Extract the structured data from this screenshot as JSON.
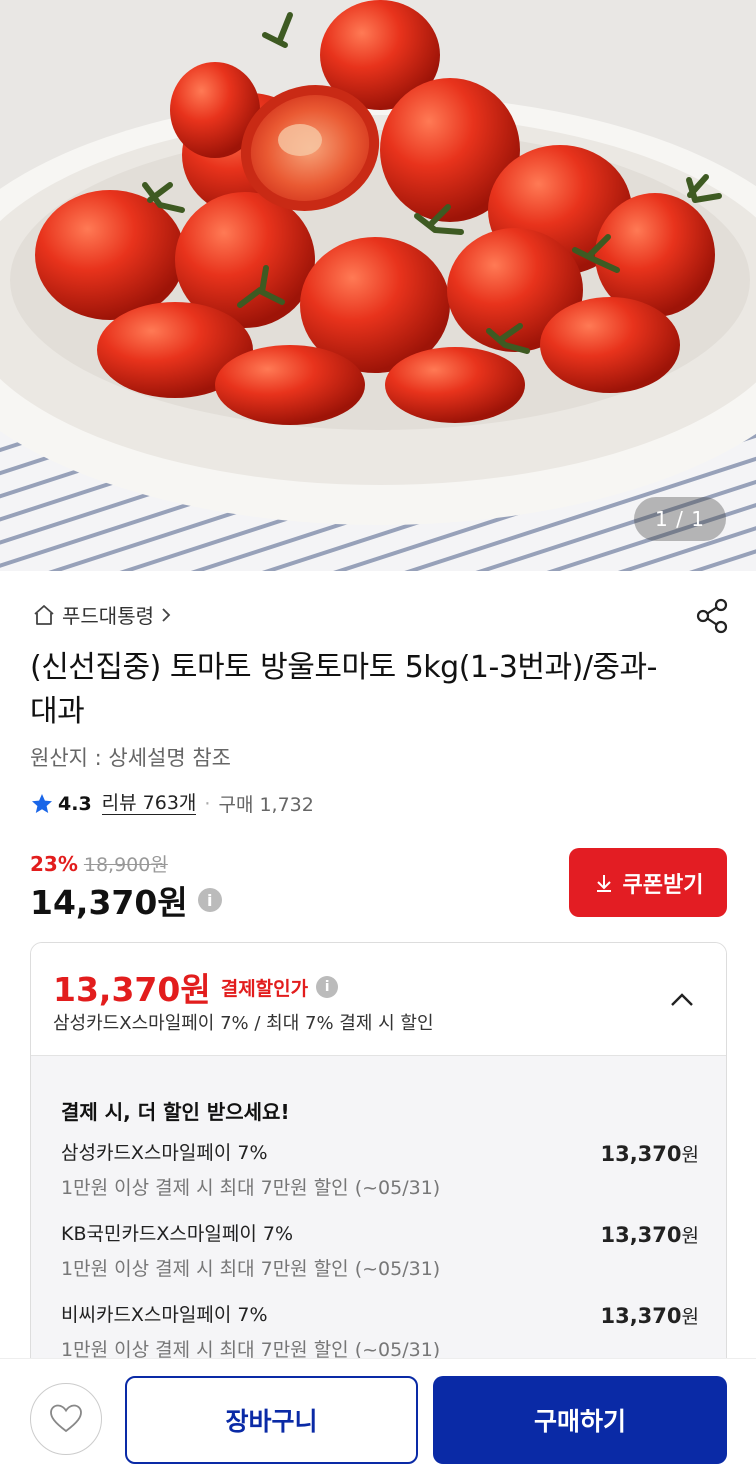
{
  "hero": {
    "image_alt": "방울토마토",
    "counter": "1 / 1"
  },
  "breadcrumb": {
    "label": "푸드대통령"
  },
  "product": {
    "title": "(신선집중) 토마토 방울토마토 5kg(1-3번과)/중과-대과",
    "origin": "원산지 : 상세설명 참조",
    "rating": "4.3",
    "review_label": "리뷰 763개",
    "purchase_label": "구매 1,732",
    "discount_pct": "23%",
    "original_price": "18,900원",
    "price": "14,370원"
  },
  "coupon": {
    "label": "쿠폰받기"
  },
  "payment": {
    "price": "13,370원",
    "price_label": "결제할인가",
    "summary": "삼성카드X스마일페이 7% / 최대 7% 결제 시 할인",
    "heading": "결제 시, 더 할인 받으세요!",
    "offers": [
      {
        "name": "삼성카드X스마일페이 7%",
        "cond": "1만원 이상 결제 시 최대 7만원 할인 (~05/31)",
        "amount": "13,370",
        "unit": "원"
      },
      {
        "name": "KB국민카드X스마일페이 7%",
        "cond": "1만원 이상 결제 시 최대 7만원 할인 (~05/31)",
        "amount": "13,370",
        "unit": "원"
      },
      {
        "name": "비씨카드X스마일페이 7%",
        "cond": "1만원 이상 결제 시 최대 7만원 할인 (~05/31)",
        "amount": "13,370",
        "unit": "원"
      }
    ]
  },
  "bottom_bar": {
    "cart_label": "장바구니",
    "buy_label": "구매하기"
  },
  "colors": {
    "accent_red": "#e31d23",
    "brand_blue": "#0a2aa6",
    "star_blue": "#1a66e8"
  },
  "icons": [
    "home-icon",
    "chevron-right-icon",
    "share-icon",
    "star-icon",
    "info-icon",
    "download-icon",
    "chevron-up-icon",
    "heart-icon"
  ]
}
